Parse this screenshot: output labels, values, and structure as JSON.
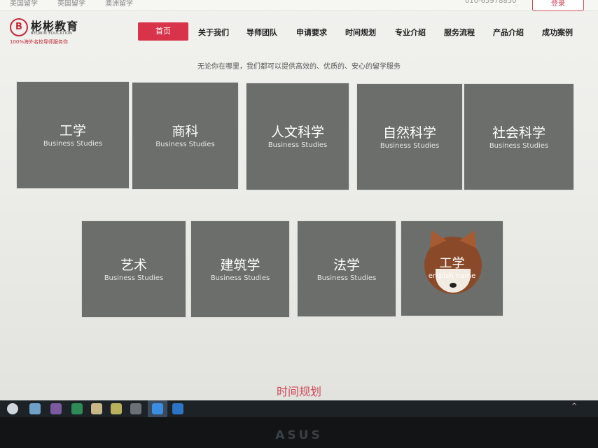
{
  "topbar": {
    "items": [
      "美国留学",
      "英国留学",
      "澳洲留学"
    ],
    "phone": "010-65978850",
    "login_label": "登录"
  },
  "logo": {
    "mark": "B",
    "name_cn": "彬彬教育",
    "name_en": "BEIJWIN EDUCATION",
    "slogan": "100%海外名校导师服务你"
  },
  "nav": {
    "items": [
      "首页",
      "关于我们",
      "导师团队",
      "申请要求",
      "时间规划",
      "专业介绍",
      "服务流程",
      "产品介绍",
      "成功案例"
    ],
    "active_index": 0
  },
  "tagline": "无论你在哪里，我们都可以提供高效的、优质的、安心的留学服务",
  "tiles": [
    {
      "title": "工学",
      "subtitle": "Business Studies"
    },
    {
      "title": "商科",
      "subtitle": "Business Studies"
    },
    {
      "title": "人文科学",
      "subtitle": "Business Studies"
    },
    {
      "title": "自然科学",
      "subtitle": "Business Studies"
    },
    {
      "title": "社会科学",
      "subtitle": "Business Studies"
    },
    {
      "title": "艺术",
      "subtitle": "Business Studies"
    },
    {
      "title": "建筑学",
      "subtitle": "Business Studies"
    },
    {
      "title": "法学",
      "subtitle": "Business Studies"
    },
    {
      "title": "工学",
      "subtitle": "english name"
    }
  ],
  "section_title": "时间规划",
  "monitor_brand": "ASUS",
  "colors": {
    "accent": "#d8334a",
    "tile": "#6b6e6b"
  }
}
